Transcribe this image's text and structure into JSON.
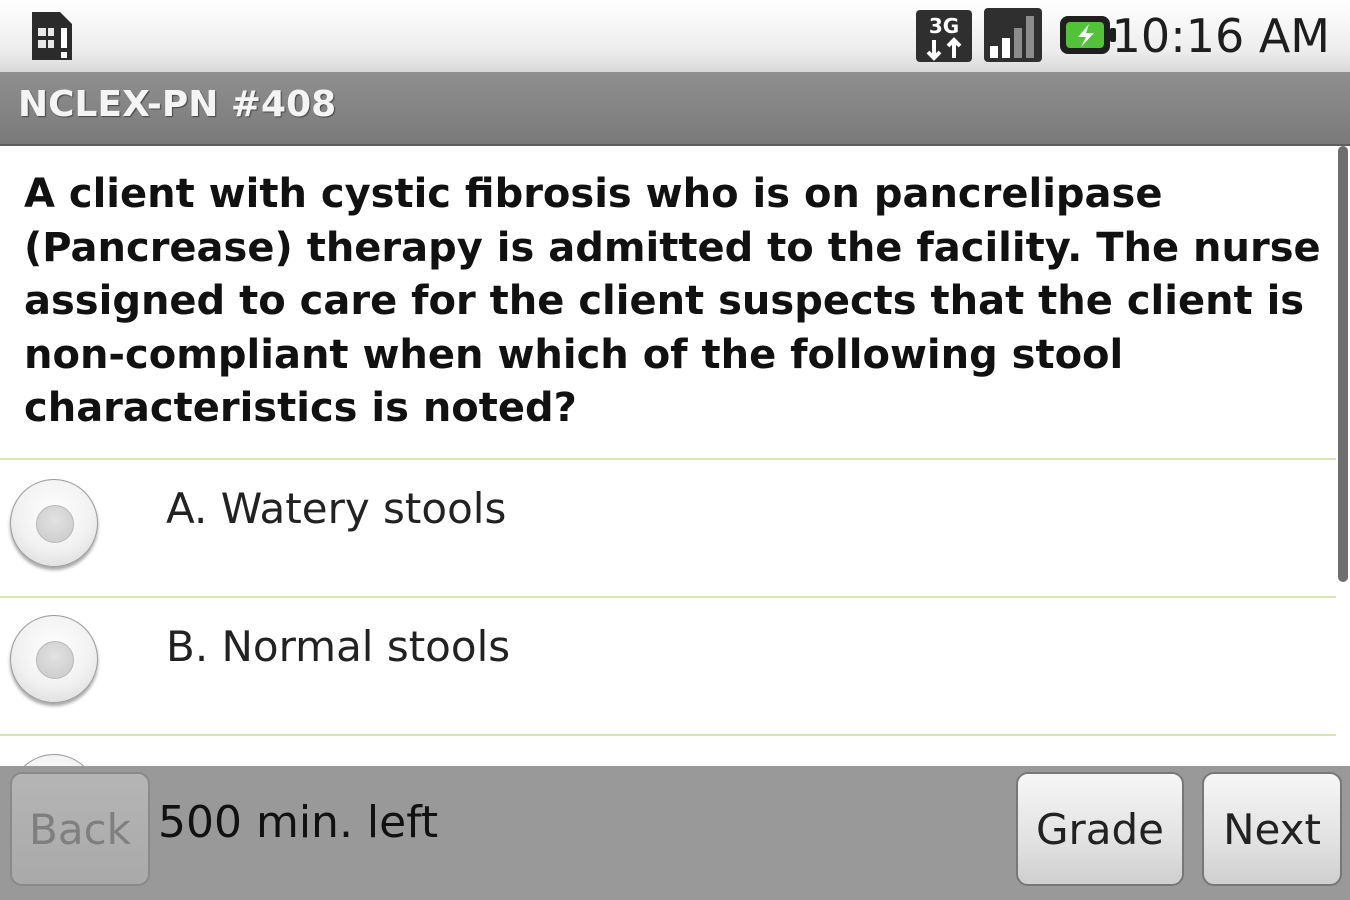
{
  "status_bar": {
    "time": "10:16 AM",
    "network_label": "3G",
    "icons": [
      "sim-notification-icon",
      "3g-data-icon",
      "signal-strength-icon",
      "battery-charging-icon"
    ]
  },
  "title_bar": {
    "title": "NCLEX-PN #408"
  },
  "question": {
    "text": "A client with cystic fibrosis who is on pancrelipase (Pancrease) therapy is admitted to the facility. The nurse assigned to care for the client suspects that the client is non-compliant when which of the following stool characteristics is noted?"
  },
  "options": [
    {
      "label": "A. Watery stools",
      "selected": false
    },
    {
      "label": "B. Normal stools",
      "selected": false
    }
  ],
  "bottom_bar": {
    "back_label": "Back",
    "timer_text": "500 min. left",
    "grade_label": "Grade",
    "next_label": "Next"
  },
  "colors": {
    "title_bar_bg": "#7a7a7a",
    "divider": "#d6e5b4",
    "bottom_bar_bg": "#999999"
  }
}
